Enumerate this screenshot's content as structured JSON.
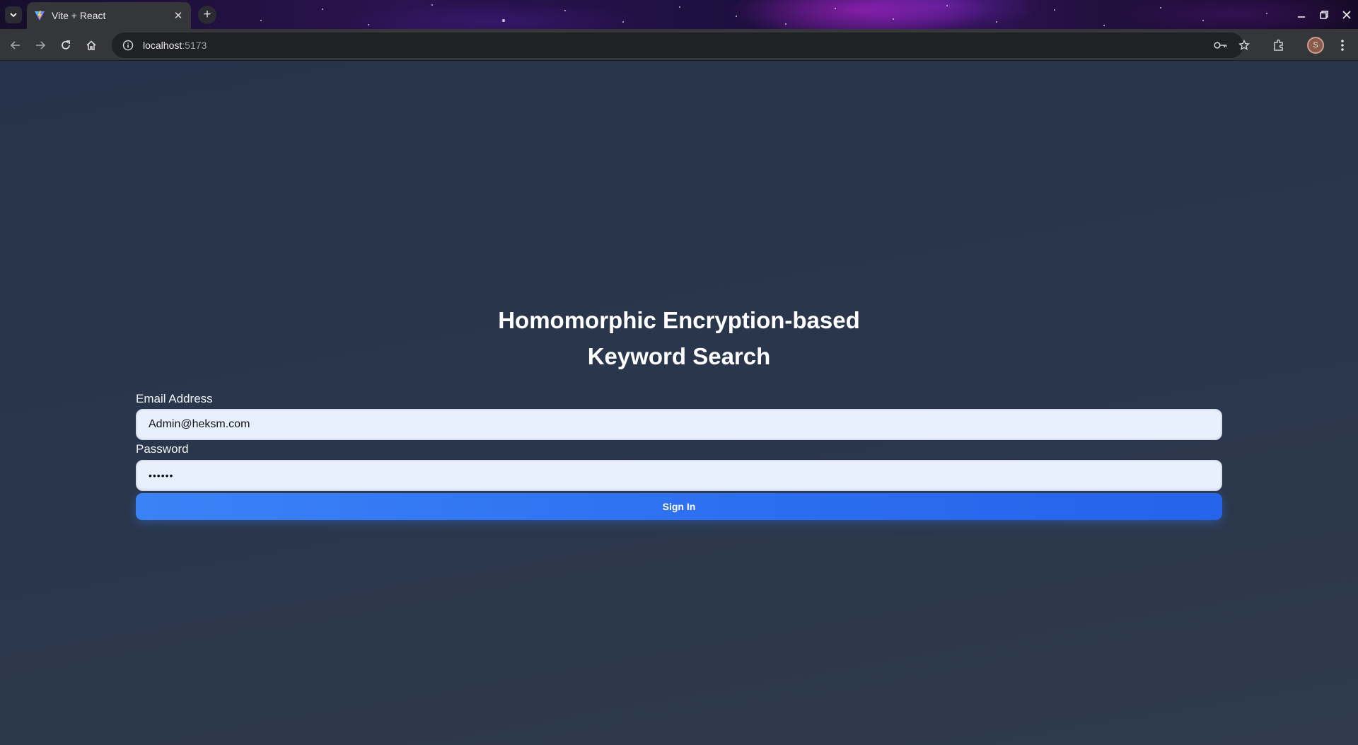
{
  "browser": {
    "tab": {
      "title": "Vite + React"
    },
    "address": {
      "host": "localhost",
      "port": ":5173"
    },
    "profile_initial": "S"
  },
  "login": {
    "title_line1": "Homomorphic Encryption-based",
    "title_line2": "Keyword Search",
    "email_label": "Email Address",
    "email_value": "Admin@heksm.com",
    "password_label": "Password",
    "password_value": "••••••",
    "signin_label": "Sign In"
  },
  "colors": {
    "page_background": "#283447",
    "input_background": "#e8f0fe",
    "button_primary": "#3b82f6"
  },
  "icons": [
    "tab-search-icon",
    "vite-favicon-icon",
    "close-icon",
    "plus-icon",
    "minimize-icon",
    "restore-icon",
    "window-close-icon",
    "back-icon",
    "forward-icon",
    "reload-icon",
    "home-icon",
    "info-icon",
    "key-icon",
    "star-icon",
    "extensions-icon",
    "menu-icon"
  ]
}
